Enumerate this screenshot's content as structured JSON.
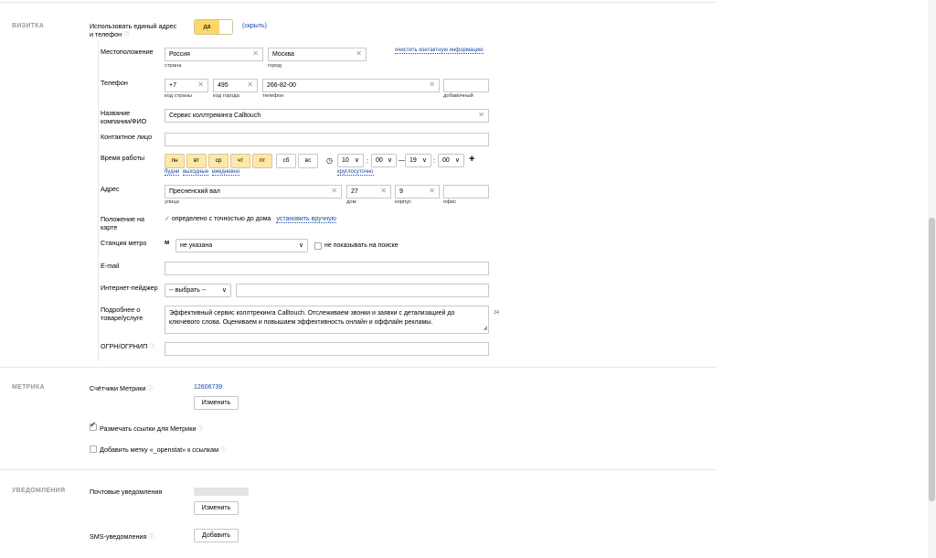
{
  "sections": {
    "vizitka": "ВИЗИТКА",
    "metrika": "МЕТРИКА",
    "notifications": "УВЕДОМЛЕНИЯ"
  },
  "vizitka": {
    "single_address_label_1": "Использовать единый адрес",
    "single_address_label_2": "и телефон",
    "toggle_on": "да",
    "hide_link": "(скрыть)",
    "location_label": "Местоположение",
    "country_value": "Россия",
    "country_caption": "страна",
    "city_value": "Москва",
    "city_caption": "город",
    "clear_contact_link": "очистить контактную информацию",
    "phone_label": "Телефон",
    "country_code_value": "+7",
    "country_code_caption": "код страны",
    "city_code_value": "495",
    "city_code_caption": "код города",
    "phone_value": "266-82-00",
    "phone_caption": "телефон",
    "ext_value": "",
    "ext_caption": "добавочный",
    "company_label_1": "Название",
    "company_label_2": "компании/ФИО",
    "company_value": "Сервис коллтрекинга Calltouch",
    "contact_label": "Контактное лицо",
    "contact_value": "",
    "hours_label": "Время работы",
    "days": [
      {
        "label": "пн",
        "on": true
      },
      {
        "label": "вт",
        "on": true
      },
      {
        "label": "ср",
        "on": true
      },
      {
        "label": "чт",
        "on": true
      },
      {
        "label": "пт",
        "on": true
      },
      {
        "label": "сб",
        "on": false
      },
      {
        "label": "вс",
        "on": false
      }
    ],
    "day_presets": [
      "будни",
      "выходные",
      "ежедневно"
    ],
    "clock_icon": "clock-icon",
    "from_hour": "10",
    "from_min": "00",
    "dash": "—",
    "to_hour": "19",
    "to_min": "00",
    "colon": ":",
    "plus": "+",
    "round_clock_link": "круглосуточно",
    "address_label": "Адрес",
    "street_value": "Пресненский вал",
    "street_caption": "улица",
    "house_value": "27",
    "house_caption": "дом",
    "building_value": "9",
    "building_caption": "корпус",
    "office_value": "",
    "office_caption": "офис",
    "map_label_1": "Положение на",
    "map_label_2": "карте",
    "map_status": "определено с точностью до дома",
    "map_set_link": "установить вручную",
    "metro_label": "Станция метро",
    "metro_icon": "м",
    "metro_value": "не указана",
    "metro_hide_label": "не показывать на поиске",
    "email_label": "E-mail",
    "email_value": "",
    "pager_label": "Интернет-пейджер",
    "pager_select": "-- выбрать --",
    "pager_value": "",
    "details_label_1": "Подробнее о",
    "details_label_2": "товаре/услуге",
    "details_value": "Эффективный сервис коллтрекинга Calltouch. Отслеживаем звонки и заявки с детализацией до ключевого слова. Оцениваем и повышаем эффективность онлайн и оффлайн рекламы.",
    "details_counter": "34",
    "ogrn_label": "ОГРН/ОГРНИП",
    "ogrn_value": ""
  },
  "metrika": {
    "counters_label": "Счётчики Метрики",
    "counter_id": "12606739",
    "change_button": "Изменить",
    "mark_links_label": "Размечать ссылки для Метрики",
    "mark_links_checked": true,
    "openstat_label": "Добавить метку «_openstat» к ссылкам",
    "openstat_checked": false
  },
  "notifications": {
    "email_label": "Почтовые уведомления",
    "change_button": "Изменить",
    "sms_label": "SMS-уведомления",
    "add_button": "Добавить"
  },
  "help_icon": "question-circle-icon",
  "colors": {
    "accent_yellow": "#fcd869",
    "link_blue": "#1a4aa8",
    "check_green": "#3aa53a"
  }
}
